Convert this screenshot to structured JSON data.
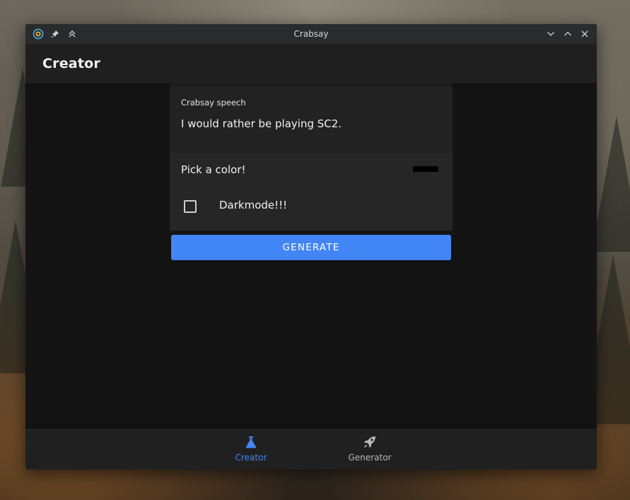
{
  "window": {
    "title": "Crabsay",
    "controls": [
      "chevron-down-icon",
      "chevron-up-icon",
      "close-icon"
    ]
  },
  "header": {
    "title": "Creator"
  },
  "form": {
    "speech_label": "Crabsay speech",
    "speech_value": "I would rather be playing SC2.",
    "color_label": "Pick a color!",
    "color_value": "#000000",
    "darkmode_label": "Darkmode!!!",
    "darkmode_checked": false,
    "generate_label": "GENERATE"
  },
  "bottom_nav": {
    "items": [
      {
        "label": "Creator",
        "icon": "flask-icon",
        "active": true
      },
      {
        "label": "Generator",
        "icon": "rocket-icon",
        "active": false
      }
    ]
  },
  "colors": {
    "accent": "#4285f4",
    "background": "#141414",
    "surface": "#262626"
  }
}
